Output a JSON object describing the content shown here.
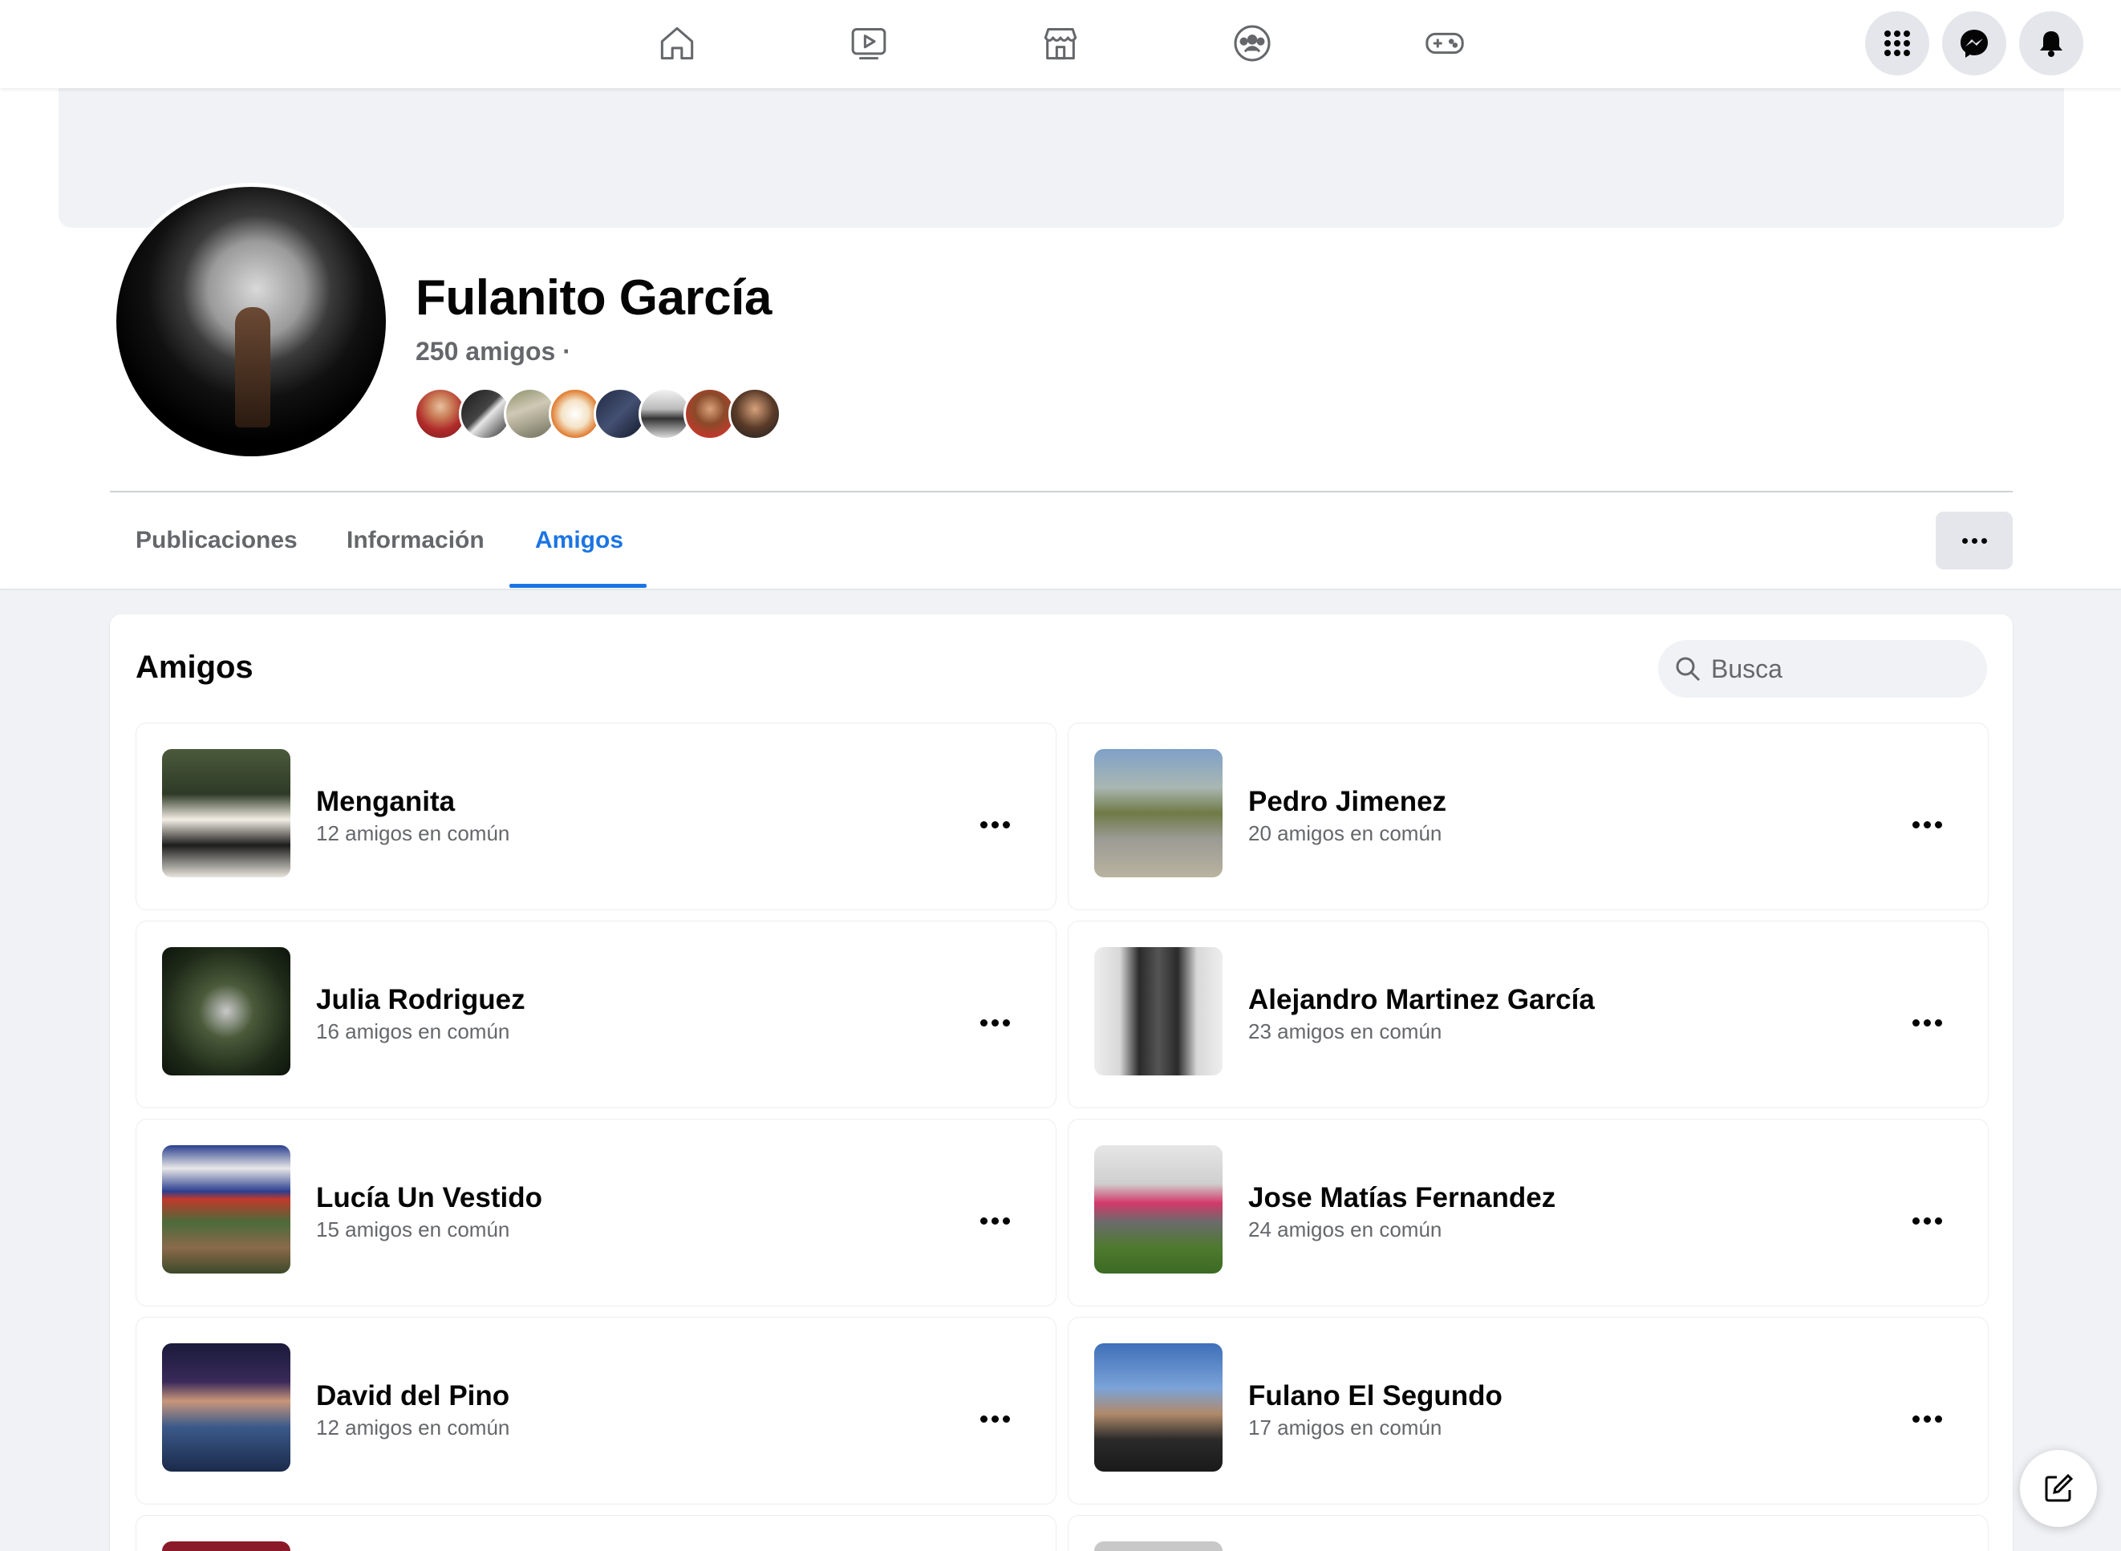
{
  "nav": {
    "icons": [
      "home-icon",
      "watch-icon",
      "marketplace-icon",
      "groups-icon",
      "gaming-icon"
    ],
    "right_icons": [
      "menu-grid-icon",
      "messenger-icon",
      "notifications-icon"
    ]
  },
  "profile": {
    "name": "Fulanito García",
    "friends_count": "250 amigos ·"
  },
  "tabs": [
    {
      "label": "Publicaciones",
      "active": false
    },
    {
      "label": "Información",
      "active": false
    },
    {
      "label": "Amigos",
      "active": true
    }
  ],
  "friends_section": {
    "title": "Amigos",
    "search_placeholder": "Busca"
  },
  "friends": [
    {
      "name": "Menganita",
      "mutual": "12 amigos en común"
    },
    {
      "name": "Pedro Jimenez",
      "mutual": "20 amigos en común"
    },
    {
      "name": "Julia Rodriguez",
      "mutual": "16 amigos en común"
    },
    {
      "name": "Alejandro Martinez García",
      "mutual": "23 amigos en común"
    },
    {
      "name": "Lucía Un Vestido",
      "mutual": "15 amigos en común"
    },
    {
      "name": "Jose Matías Fernandez",
      "mutual": "24 amigos en común"
    },
    {
      "name": "David del Pino",
      "mutual": "12 amigos en común"
    },
    {
      "name": "Fulano El Segundo",
      "mutual": "17 amigos en común"
    }
  ],
  "colors": {
    "accent": "#1b74e4",
    "secondary_text": "#65676b",
    "background": "#f0f2f5"
  }
}
